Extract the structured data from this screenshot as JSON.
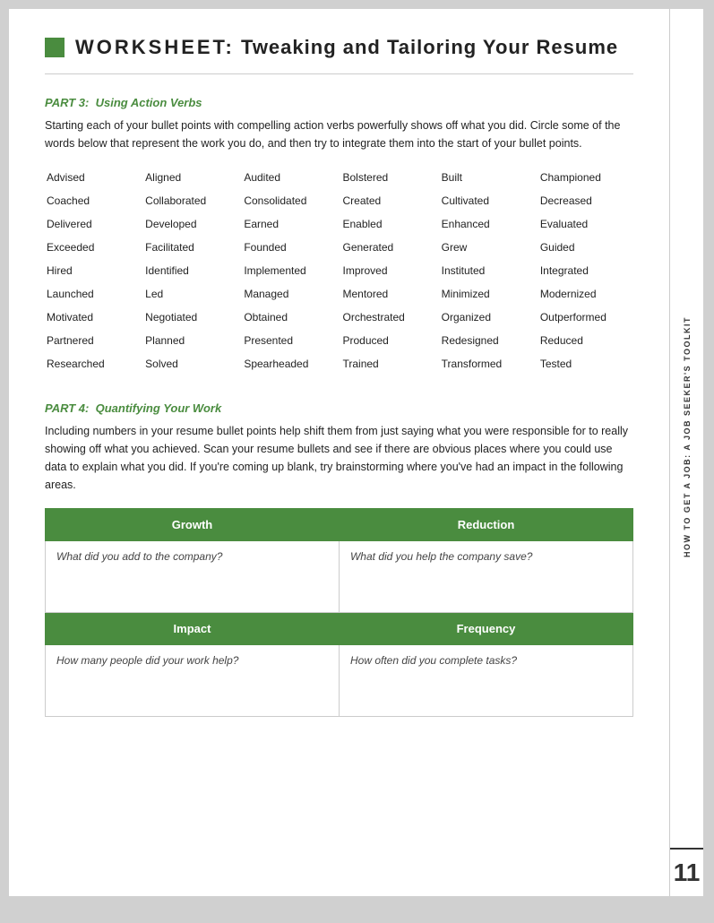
{
  "header": {
    "label": "WORKSHEET:",
    "subtitle": "Tweaking and Tailoring Your Resume",
    "square_color": "#4a8c3f"
  },
  "side_tab": {
    "text": "HOW TO GET A JOB: A JOB SEEKER'S TOOLKIT",
    "number": "11"
  },
  "part3": {
    "label": "PART 3:",
    "title": "Using Action Verbs",
    "body": "Starting each of your bullet points with compelling action verbs powerfully shows off what you did. Circle some of the words below that represent the work you do, and then try to integrate them into the start of your bullet points."
  },
  "verbs": [
    "Advised",
    "Aligned",
    "Audited",
    "Bolstered",
    "Built",
    "Championed",
    "Coached",
    "Collaborated",
    "Consolidated",
    "Created",
    "Cultivated",
    "Decreased",
    "Delivered",
    "Developed",
    "Earned",
    "Enabled",
    "Enhanced",
    "Evaluated",
    "Exceeded",
    "Facilitated",
    "Founded",
    "Generated",
    "Grew",
    "Guided",
    "Hired",
    "Identified",
    "Implemented",
    "Improved",
    "Instituted",
    "Integrated",
    "Launched",
    "Led",
    "Managed",
    "Mentored",
    "Minimized",
    "Modernized",
    "Motivated",
    "Negotiated",
    "Obtained",
    "Orchestrated",
    "Organized",
    "Outperformed",
    "Partnered",
    "Planned",
    "Presented",
    "Produced",
    "Redesigned",
    "Reduced",
    "Researched",
    "Solved",
    "Spearheaded",
    "Trained",
    "Transformed",
    "Tested"
  ],
  "part4": {
    "label": "PART 4:",
    "title": "Quantifying Your Work",
    "body": "Including numbers in your resume bullet points help shift them from just saying what you were responsible for to really showing off what you achieved. Scan your resume bullets and see if there are obvious places where you could use data to explain what you did. If you're coming up blank, try brainstorming where you've had an impact in the following areas."
  },
  "table": {
    "rows": [
      {
        "col1_header": "Growth",
        "col2_header": "Reduction",
        "col1_question": "What did you add to the company?",
        "col2_question": "What did you help the company save?"
      },
      {
        "col1_header": "Impact",
        "col2_header": "Frequency",
        "col1_question": "How many people did your work help?",
        "col2_question": "How often did you complete tasks?"
      }
    ]
  }
}
